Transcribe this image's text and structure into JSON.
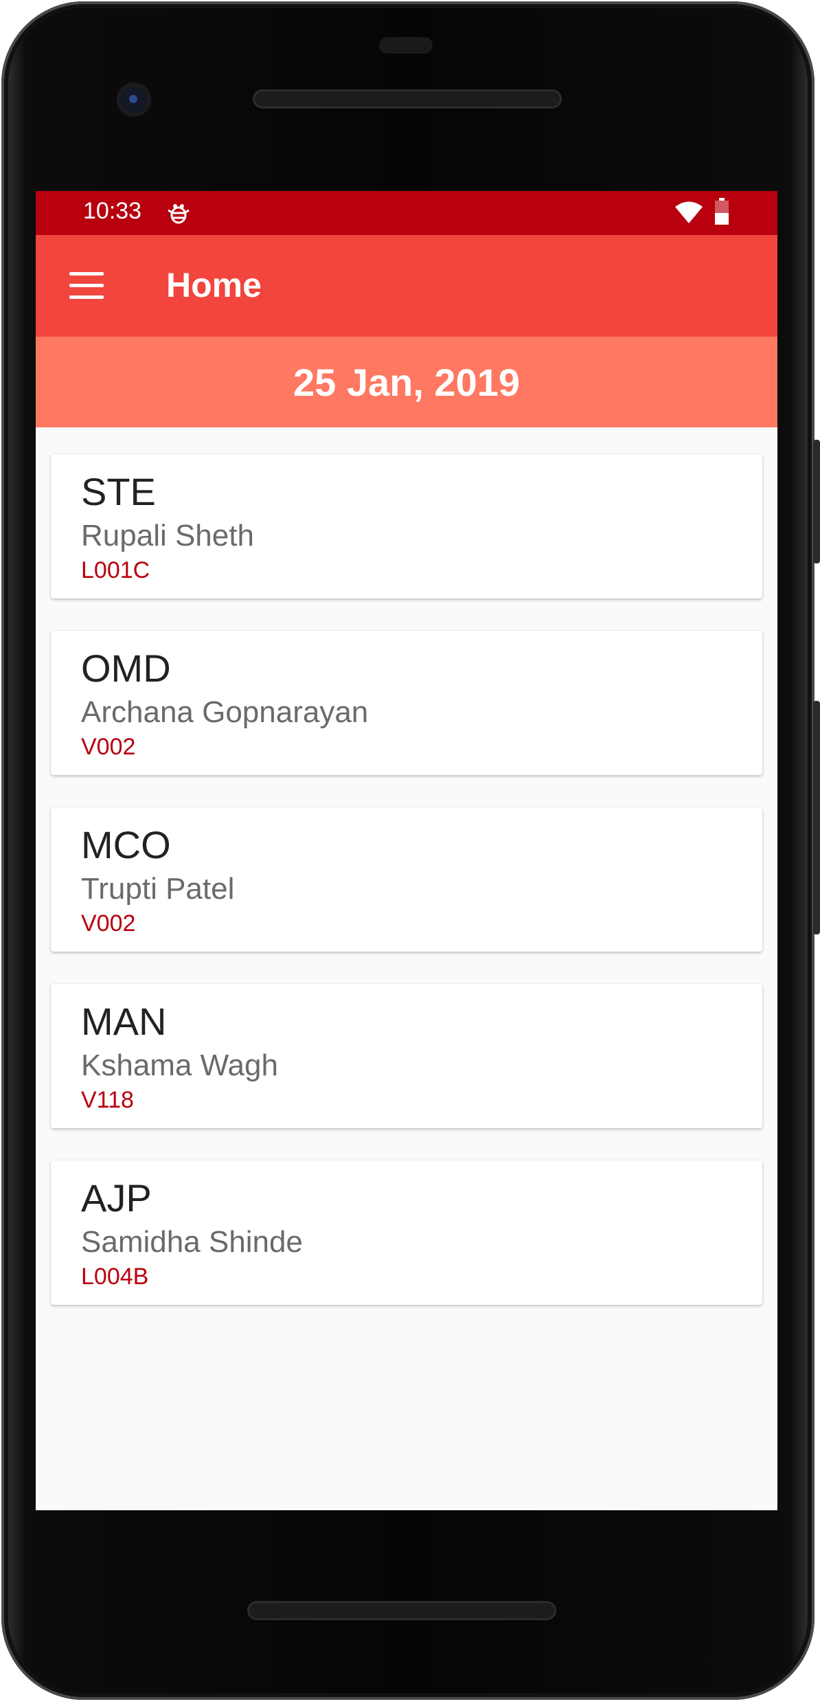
{
  "status_bar": {
    "time": "10:33",
    "icons": [
      "bug-icon",
      "wifi-icon",
      "battery-icon"
    ]
  },
  "app_bar": {
    "title": "Home",
    "menu_icon": "hamburger-menu-icon"
  },
  "date_header": {
    "date": "25 Jan, 2019"
  },
  "items": [
    {
      "code": "STE",
      "name": "Rupali Sheth",
      "id": "L001C"
    },
    {
      "code": "OMD",
      "name": "Archana Gopnarayan",
      "id": "V002"
    },
    {
      "code": "MCO",
      "name": "Trupti Patel",
      "id": "V002"
    },
    {
      "code": "MAN",
      "name": "Kshama Wagh",
      "id": "V118"
    },
    {
      "code": "AJP",
      "name": "Samidha Shinde",
      "id": "L004B"
    }
  ],
  "colors": {
    "status_bar": "#b8000e",
    "app_bar": "#f2453d",
    "date_bar": "#fe7862",
    "accent_text": "#b8000e",
    "background": "#fafafa"
  }
}
